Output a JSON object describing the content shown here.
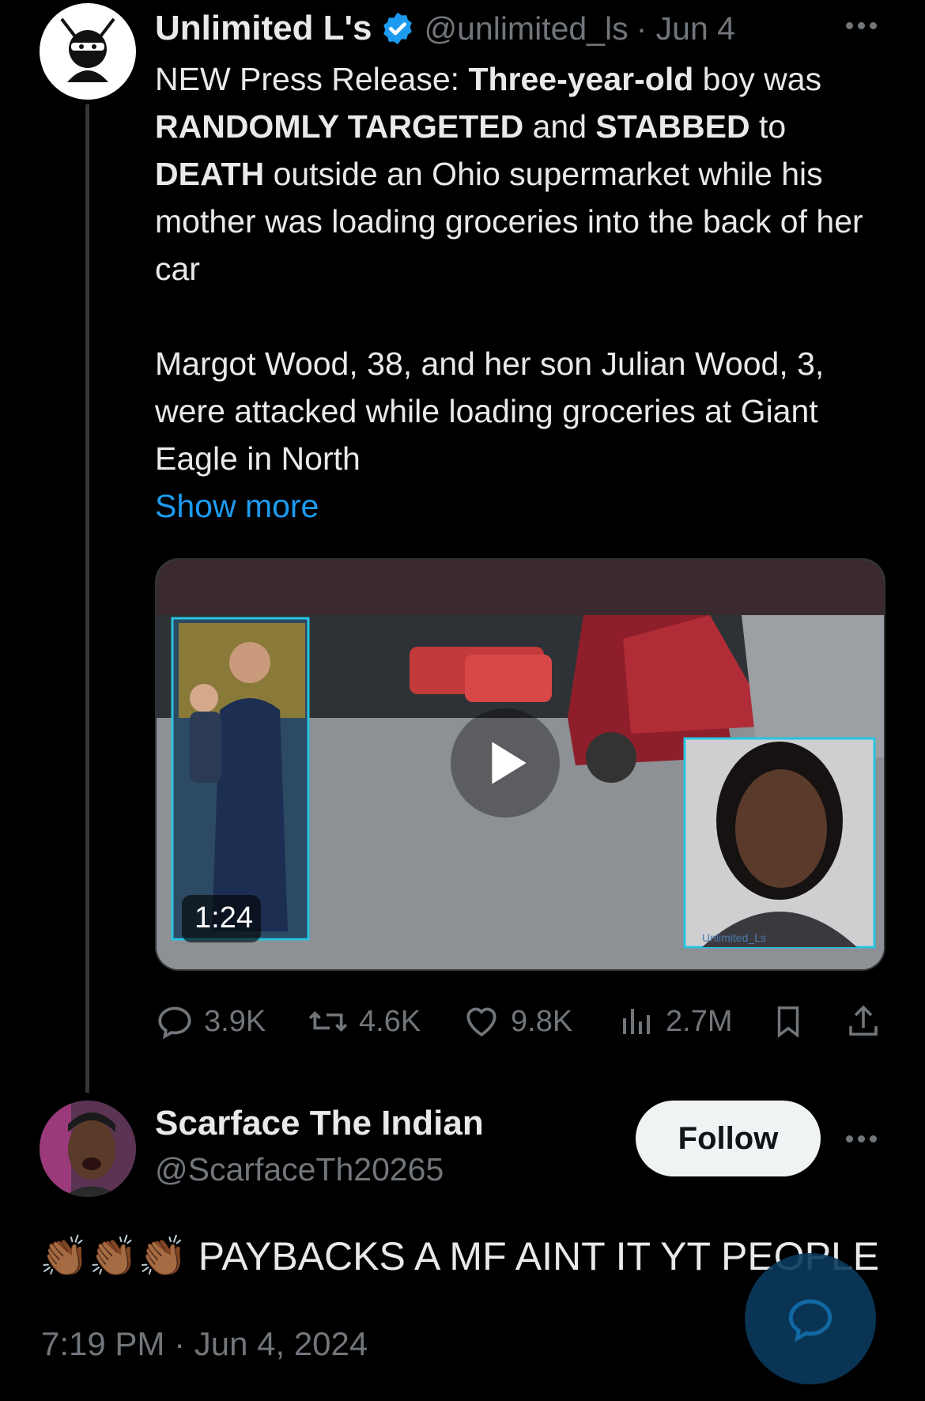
{
  "tweet": {
    "author_name": "Unlimited L's",
    "handle": "@unlimited_ls",
    "date": "· Jun 4",
    "text_segments": [
      {
        "t": "NEW Press Release: ",
        "bold": false
      },
      {
        "t": "Three-year-old",
        "bold": true
      },
      {
        "t": " boy was ",
        "bold": false
      },
      {
        "t": "RANDOMLY TARGETED",
        "bold": true
      },
      {
        "t": " and ",
        "bold": false
      },
      {
        "t": "STABBED",
        "bold": true
      },
      {
        "t": " to ",
        "bold": false
      },
      {
        "t": "DEATH",
        "bold": true
      },
      {
        "t": " outside an Ohio supermarket while his mother was loading groceries into the back of her car",
        "bold": false
      }
    ],
    "paragraph2": "Margot Wood, 38, and her son Julian Wood, 3, were attacked while loading groceries at Giant Eagle in North",
    "show_more": "Show more",
    "video": {
      "duration": "1:24",
      "watermark": "Unlimited_Ls"
    },
    "stats": {
      "replies": "3.9K",
      "reposts": "4.6K",
      "likes": "9.8K",
      "views": "2.7M"
    }
  },
  "reply": {
    "author_name": "Scarface The Indian",
    "handle": "@ScarfaceTh20265",
    "follow_label": "Follow",
    "emoji": "👏🏾👏🏾👏🏾",
    "text": "PAYBACKS A MF AINT IT YT PEOPLE",
    "timestamp": "7:19 PM · Jun 4, 2024"
  },
  "colors": {
    "accent": "#1d9bf0",
    "muted": "#71767b",
    "background": "#000000"
  },
  "icons": [
    "reply-icon",
    "repost-icon",
    "like-icon",
    "views-icon",
    "bookmark-icon",
    "share-icon",
    "verified-badge-icon",
    "more-icon",
    "play-icon",
    "compose-reply-icon"
  ]
}
